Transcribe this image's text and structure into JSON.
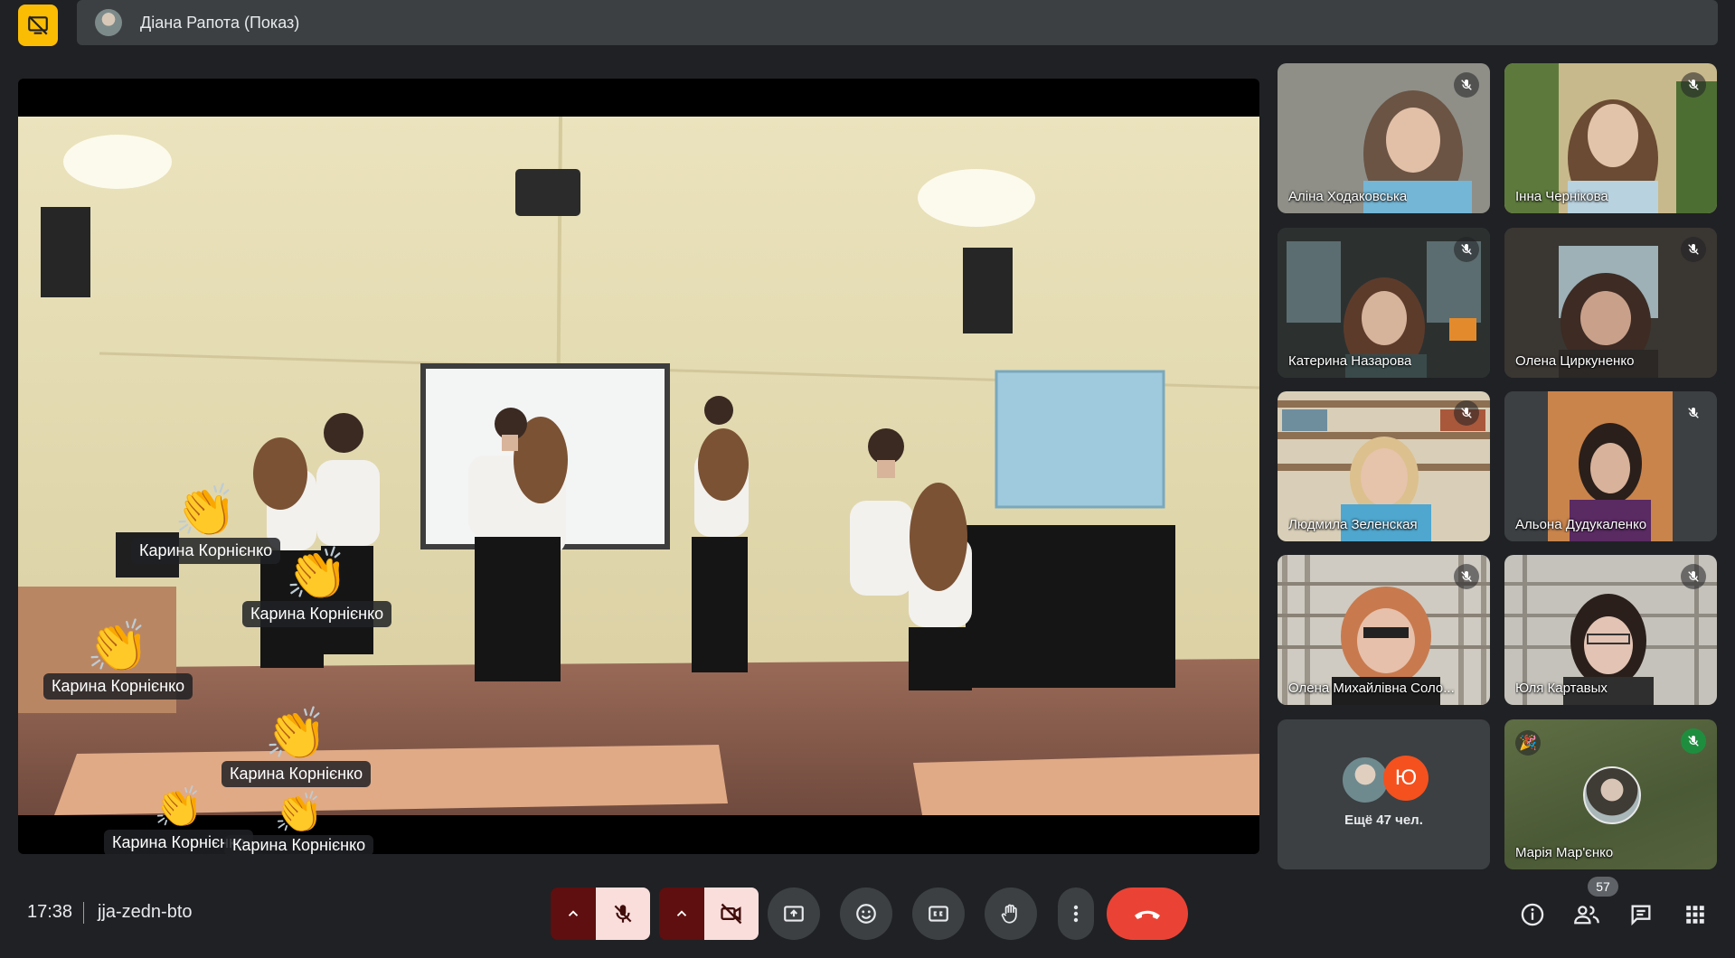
{
  "banner": {
    "presenter": "Діана Рапота (Показ)"
  },
  "reactions": [
    {
      "name": "Карина Корнієнко"
    },
    {
      "name": "Карина Корнієнко"
    },
    {
      "name": "Карина Корнієнко"
    },
    {
      "name": "Карина Корнієнко"
    },
    {
      "name": "Карина Корнієнко"
    },
    {
      "name": "Карина Корнієнко"
    }
  ],
  "participants": [
    {
      "name": "Аліна Ходаковська"
    },
    {
      "name": "Інна Чернікова"
    },
    {
      "name": "Катерина Назарова"
    },
    {
      "name": "Олена Циркуненко"
    },
    {
      "name": "Людмила Зеленская"
    },
    {
      "name": "Альона Дудукаленко"
    },
    {
      "name": "Олена Михайлівна Соло..."
    },
    {
      "name": "Юля Картавых"
    }
  ],
  "more_tile": {
    "avatar_initial": "Ю",
    "label": "Ещё 47 чел."
  },
  "maria_tile": {
    "name": "Марія Мар'єнко"
  },
  "bottom": {
    "time": "17:38",
    "meeting_code": "jja-zedn-bto",
    "people_count": "57"
  },
  "colors": {
    "background": "#202124",
    "accent_yellow": "#fbbc04",
    "hangup_red": "#ea4335",
    "control_gray": "#3c4043"
  }
}
